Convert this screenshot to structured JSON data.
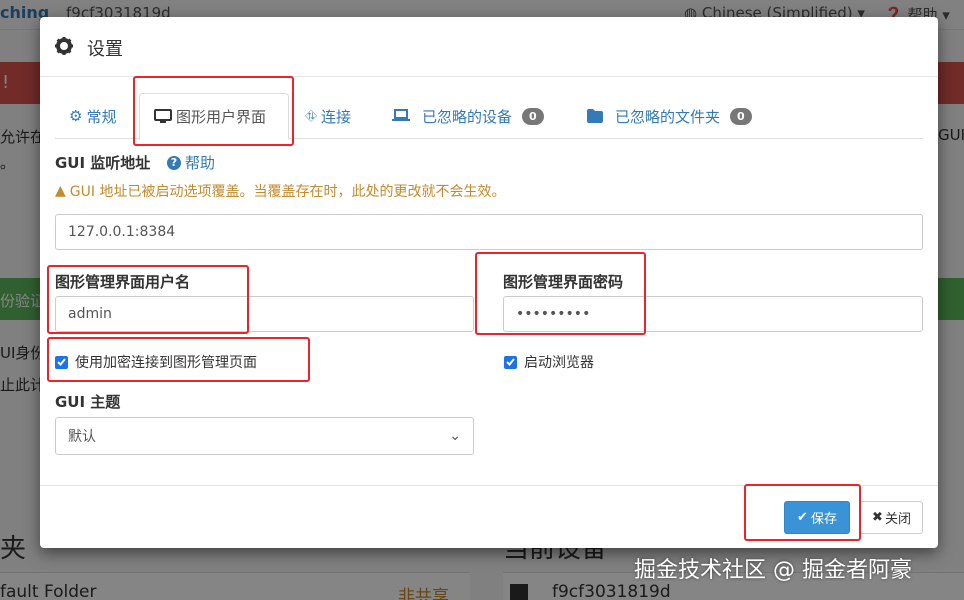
{
  "background": {
    "brand": "ching",
    "device_id": "f9cf3031819d",
    "language_menu": "Chinese (Simplified)",
    "help_menu": "帮助",
    "alert_mark": "!",
    "text_1": "允许在",
    "text_2": "。",
    "text_3": "GUI",
    "green_text": "份验证",
    "text_4": "UI身份",
    "text_5": "止此计",
    "heading_left": "夹",
    "heading_right": "当前设备",
    "folder_name": "fault Folder",
    "folder_status": "非共享",
    "device_name": "f9cf3031819d"
  },
  "modal": {
    "title": "设置",
    "tabs": [
      {
        "label": "常规",
        "icon": "gear-icon"
      },
      {
        "label": "图形用户界面",
        "icon": "desktop-icon"
      },
      {
        "label": "连接",
        "icon": "sitemap-icon"
      },
      {
        "label": "已忽略的设备",
        "icon": "laptop-icon",
        "badge": "0"
      },
      {
        "label": "已忽略的文件夹",
        "icon": "folder-icon",
        "badge": "0"
      }
    ],
    "listen_label": "GUI 监听地址",
    "help_label": "帮助",
    "warning": "GUI 地址已被启动选项覆盖。当覆盖存在时，此处的更改就不会生效。",
    "listen_value": "127.0.0.1:8384",
    "username_label": "图形管理界面用户名",
    "username_value": "admin",
    "password_label": "图形管理界面密码",
    "password_value": "•••••••••",
    "https_label": "使用加密连接到图形管理页面",
    "https_checked": true,
    "browser_label": "启动浏览器",
    "browser_checked": true,
    "theme_label": "GUI 主题",
    "theme_value": "默认",
    "save_label": "保存",
    "close_label": "关闭"
  },
  "watermark": "掘金技术社区 @ 掘金者阿豪",
  "colors": {
    "link": "#337ab7",
    "warning": "#c48a2c",
    "primary_button": "#3a93d6",
    "highlight": "#e8252b"
  }
}
